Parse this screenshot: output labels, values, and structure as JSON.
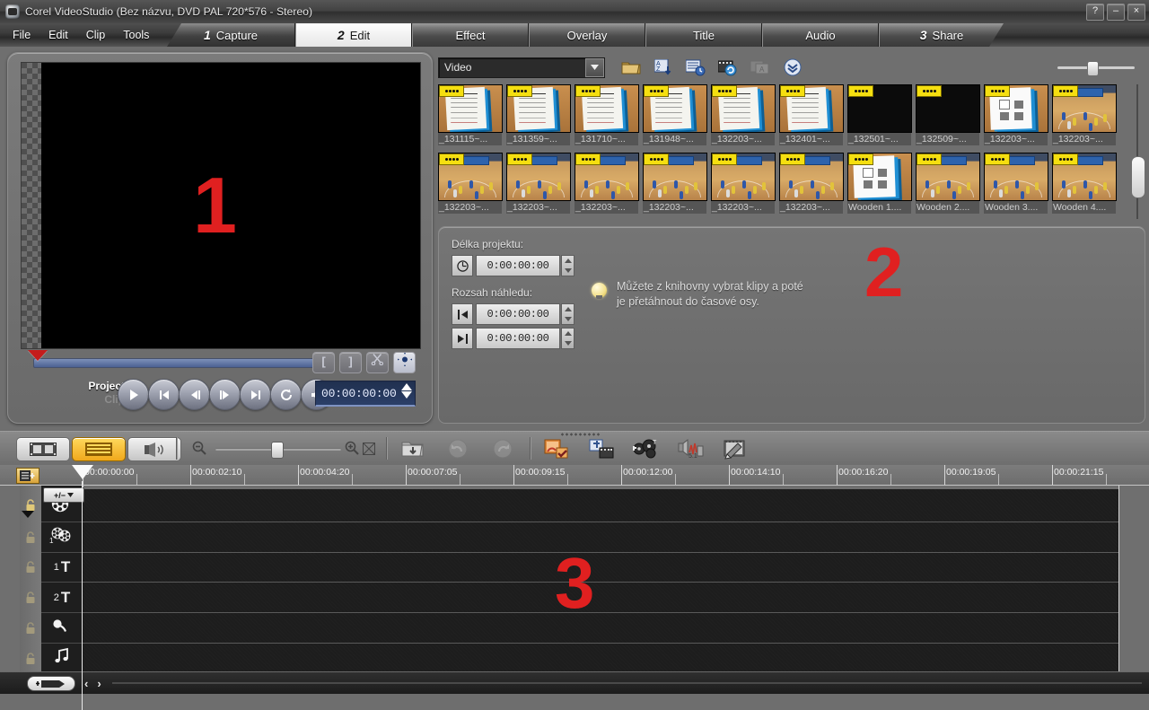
{
  "window": {
    "title": "Corel VideoStudio (Bez názvu, DVD PAL 720*576 - Stereo)",
    "help_label": "?",
    "minimize_label": "–",
    "close_label": "×"
  },
  "menu": {
    "items": [
      {
        "label": "File"
      },
      {
        "label": "Edit"
      },
      {
        "label": "Clip"
      },
      {
        "label": "Tools"
      }
    ]
  },
  "steps": [
    {
      "num": "1",
      "label": "Capture",
      "active": false
    },
    {
      "num": "2",
      "label": "Edit",
      "active": true
    },
    {
      "num": "",
      "label": "Effect",
      "active": false
    },
    {
      "num": "",
      "label": "Overlay",
      "active": false
    },
    {
      "num": "",
      "label": "Title",
      "active": false
    },
    {
      "num": "",
      "label": "Audio",
      "active": false
    },
    {
      "num": "3",
      "label": "Share",
      "active": false
    }
  ],
  "annotations": {
    "num1": "1",
    "num2": "2",
    "num3": "3",
    "color": "#e02020"
  },
  "preview": {
    "mode_project_label": "Project",
    "mode_clip_label": "Clip",
    "timecode": "00:00:00:00",
    "mark_in_label": "[",
    "mark_out_label": "]",
    "transport": [
      {
        "name": "play-button",
        "glyph": "play"
      },
      {
        "name": "home-button",
        "glyph": "start"
      },
      {
        "name": "previous-frame-button",
        "glyph": "prev"
      },
      {
        "name": "next-frame-button",
        "glyph": "next"
      },
      {
        "name": "end-button",
        "glyph": "end"
      },
      {
        "name": "repeat-button",
        "glyph": "repeat"
      },
      {
        "name": "volume-button",
        "glyph": "volume"
      }
    ]
  },
  "library": {
    "category_value": "Video",
    "toolbar_icons": [
      {
        "name": "load-media-icon"
      },
      {
        "name": "sort-az-icon"
      },
      {
        "name": "library-options-icon"
      },
      {
        "name": "export-icon"
      },
      {
        "name": "disabled-icon"
      },
      {
        "name": "expand-chevrons-icon"
      }
    ],
    "clips_row1": [
      {
        "label": "_131115~...",
        "kind": "doc"
      },
      {
        "label": "_131359~...",
        "kind": "doc"
      },
      {
        "label": "_131710~...",
        "kind": "doc"
      },
      {
        "label": "_131948~...",
        "kind": "doc"
      },
      {
        "label": "_132203~...",
        "kind": "doc"
      },
      {
        "label": "_132401~...",
        "kind": "doc"
      },
      {
        "label": "_132501~...",
        "kind": "dark"
      },
      {
        "label": "_132509~...",
        "kind": "dark"
      },
      {
        "label": "_132203~...",
        "kind": "diag"
      },
      {
        "label": "_132203~...",
        "kind": "court"
      }
    ],
    "clips_row2": [
      {
        "label": "_132203~...",
        "kind": "court"
      },
      {
        "label": "_132203~...",
        "kind": "court"
      },
      {
        "label": "_132203~...",
        "kind": "court"
      },
      {
        "label": "_132203~...",
        "kind": "court"
      },
      {
        "label": "_132203~...",
        "kind": "court"
      },
      {
        "label": "_132203~...",
        "kind": "court"
      },
      {
        "label": "Wooden 1....",
        "kind": "diag"
      },
      {
        "label": "Wooden 2....",
        "kind": "court"
      },
      {
        "label": "Wooden 3....",
        "kind": "court"
      },
      {
        "label": "Wooden 4....",
        "kind": "court"
      }
    ]
  },
  "options": {
    "project_duration_label": "Délka projektu:",
    "project_duration_value": "0:00:00:00",
    "preview_range_label": "Rozsah náhledu:",
    "preview_range_start_value": "0:00:00:00",
    "preview_range_end_value": "0:00:00:00",
    "hint_line1": "Můžete z knihovny vybrat klipy a poté",
    "hint_line2": "je přetáhnout do časové osy."
  },
  "timeline_toolbar": {
    "views": [
      {
        "name": "storyboard-view-button",
        "selected": false
      },
      {
        "name": "timeline-view-button",
        "selected": true
      },
      {
        "name": "audio-view-button",
        "selected": false
      }
    ],
    "zoom_out_label": "−",
    "zoom_in_label": "+",
    "fit_label": "⊠",
    "icons": [
      {
        "name": "insert-media-icon"
      },
      {
        "name": "undo-icon"
      },
      {
        "name": "redo-icon"
      },
      {
        "name": "smart-package-icon"
      },
      {
        "name": "batch-convert-icon"
      },
      {
        "name": "create-disc-icon"
      },
      {
        "name": "surround-mixer-icon"
      },
      {
        "name": "paint-creator-icon"
      }
    ]
  },
  "ruler": {
    "ticks": [
      "00:00:00:00",
      "00:00:02:10",
      "00:00:04:20",
      "00:00:07:05",
      "00:00:09:15",
      "00:00:12:00",
      "00:00:14:10",
      "00:00:16:20",
      "00:00:19:05",
      "00:00:21:15"
    ]
  },
  "tracks": [
    {
      "name": "video-track",
      "icon": "film-reel",
      "label": ""
    },
    {
      "name": "overlay-track",
      "icon": "film-reel-1",
      "label": "1"
    },
    {
      "name": "title-track-1",
      "icon": "text",
      "label": "1 T"
    },
    {
      "name": "title-track-2",
      "icon": "text",
      "label": "2 T"
    },
    {
      "name": "voice-track",
      "icon": "microphone",
      "label": ""
    },
    {
      "name": "music-track",
      "icon": "music-note",
      "label": "♫"
    }
  ],
  "track_manager": {
    "label": "+/−"
  },
  "statusbar": {
    "add_button_label": "+",
    "prev_label": "‹",
    "next_label": "›"
  }
}
